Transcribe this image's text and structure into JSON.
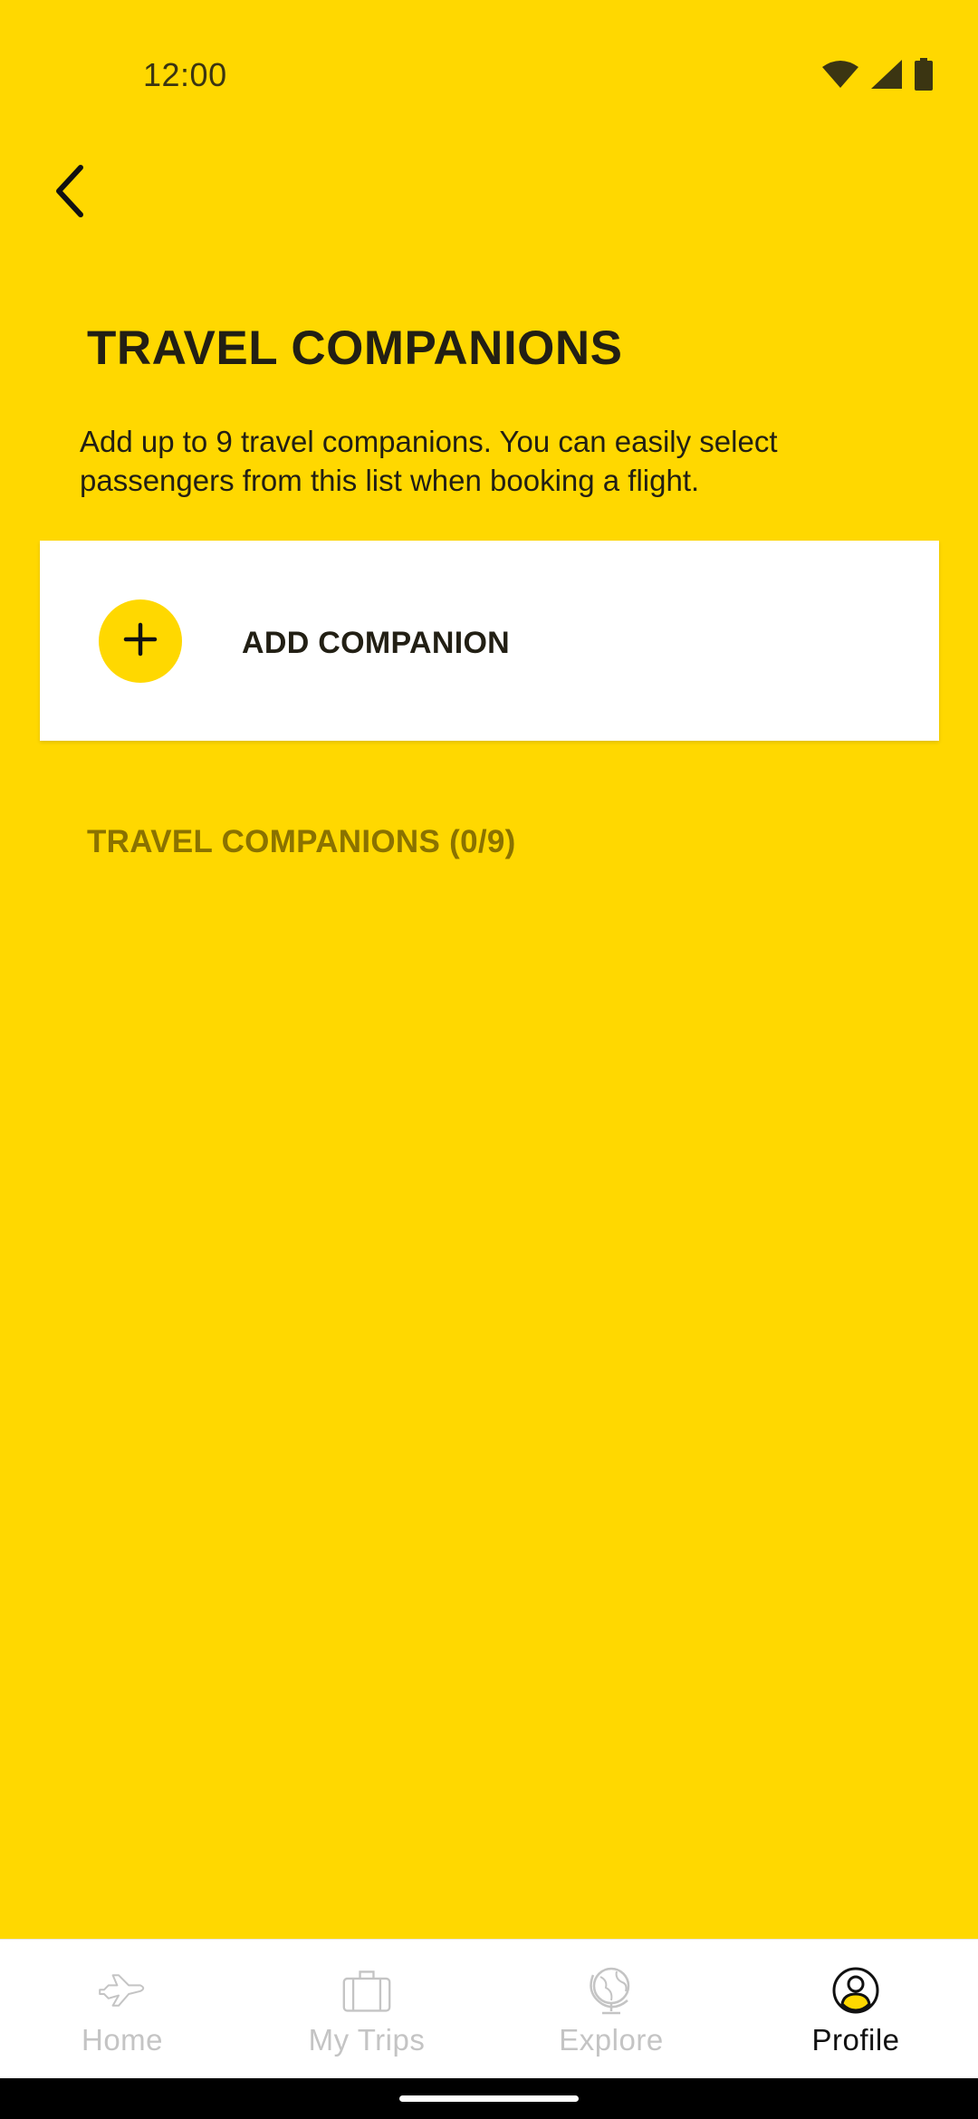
{
  "status_bar": {
    "time": "12:00",
    "icons": [
      "wifi-icon",
      "signal-icon",
      "battery-icon"
    ]
  },
  "header": {
    "back_icon": "chevron-left-icon",
    "title": "TRAVEL COMPANIONS",
    "description": "Add up to 9 travel companions. You can easily select passengers from this list when booking a flight."
  },
  "add_card": {
    "icon": "plus-icon",
    "label": "ADD COMPANION"
  },
  "companions": {
    "heading": "TRAVEL COMPANIONS (0/9)",
    "count": 0,
    "max": 9
  },
  "bottom_nav": {
    "items": [
      {
        "label": "Home",
        "icon": "airplane-icon",
        "active": false
      },
      {
        "label": "My Trips",
        "icon": "suitcase-icon",
        "active": false
      },
      {
        "label": "Explore",
        "icon": "globe-icon",
        "active": false
      },
      {
        "label": "Profile",
        "icon": "user-circle-icon",
        "active": true
      }
    ]
  },
  "colors": {
    "background": "#FFD800",
    "card": "#FFFFFF",
    "text_dark": "#221F14",
    "section_heading": "#8A7200",
    "nav_inactive": "#C4C4C4",
    "nav_active": "#111111"
  }
}
